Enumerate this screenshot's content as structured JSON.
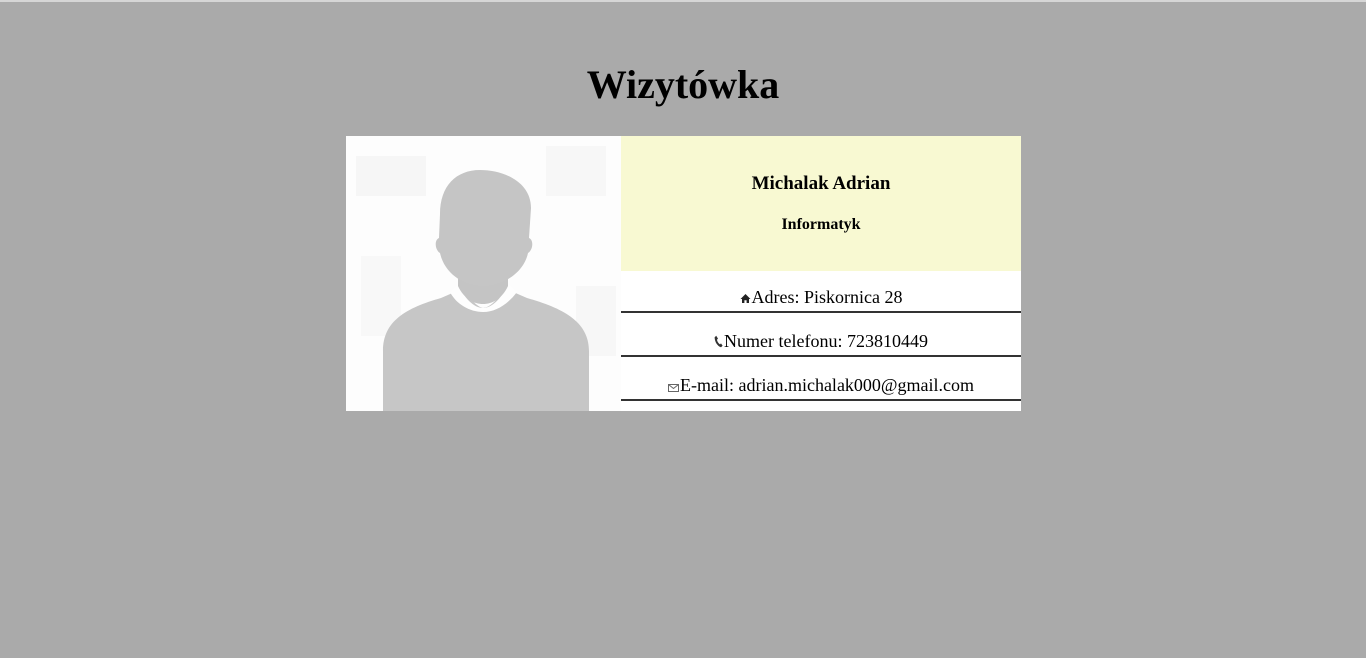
{
  "page": {
    "title": "Wizytówka",
    "background_color": "#aaaaaa"
  },
  "card": {
    "photo": {
      "icon": "avatar-placeholder-icon"
    },
    "header": {
      "name": "Michalak Adrian",
      "role": "Informatyk",
      "background_color": "#f8f9d2"
    },
    "contacts": [
      {
        "icon": "home-icon",
        "label": "Adres: Piskornica 28"
      },
      {
        "icon": "phone-icon",
        "label": "Numer telefonu: 723810449"
      },
      {
        "icon": "envelope-icon",
        "label": "E-mail: adrian.michalak000@gmail.com"
      }
    ]
  }
}
